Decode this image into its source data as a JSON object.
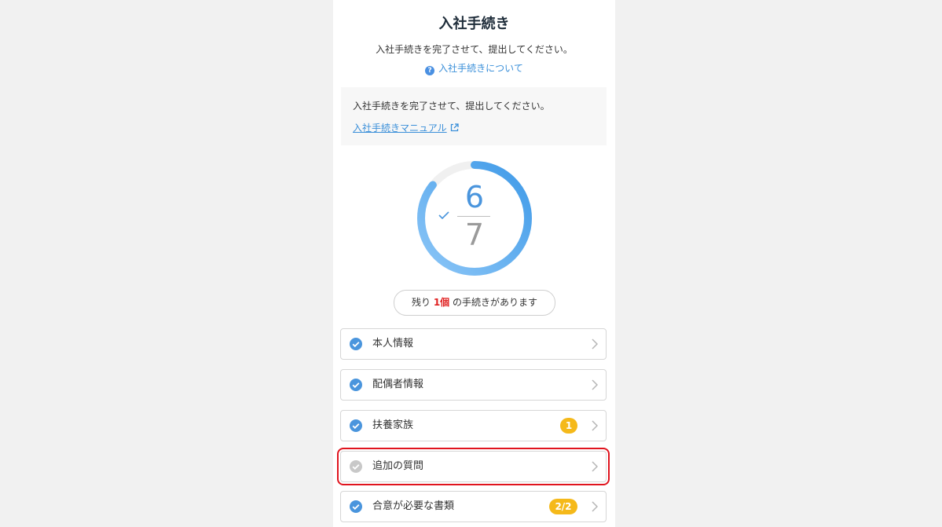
{
  "header": {
    "title": "入社手続き",
    "subtitle": "入社手続きを完了させて、提出してください。",
    "help_link": "入社手続きについて",
    "help_icon": "?"
  },
  "infobox": {
    "text": "入社手続きを完了させて、提出してください。",
    "manual_link": "入社手続きマニュアル"
  },
  "progress": {
    "completed": "6",
    "total": "7",
    "fraction": 0.857
  },
  "remaining": {
    "prefix": "残り",
    "count": "1個",
    "suffix": "の手続きがあります"
  },
  "procedures": [
    {
      "label": "本人情報",
      "status": "done",
      "badge": ""
    },
    {
      "label": "配偶者情報",
      "status": "done",
      "badge": ""
    },
    {
      "label": "扶養家族",
      "status": "done",
      "badge": "1"
    },
    {
      "label": "追加の質問",
      "status": "pending",
      "badge": ""
    },
    {
      "label": "合意が必要な書類",
      "status": "done",
      "badge": "2/2"
    }
  ],
  "colors": {
    "accent": "#4a95dd",
    "badge": "#f5b91a",
    "highlight": "#e0141e",
    "pending": "#c8c8c8"
  }
}
